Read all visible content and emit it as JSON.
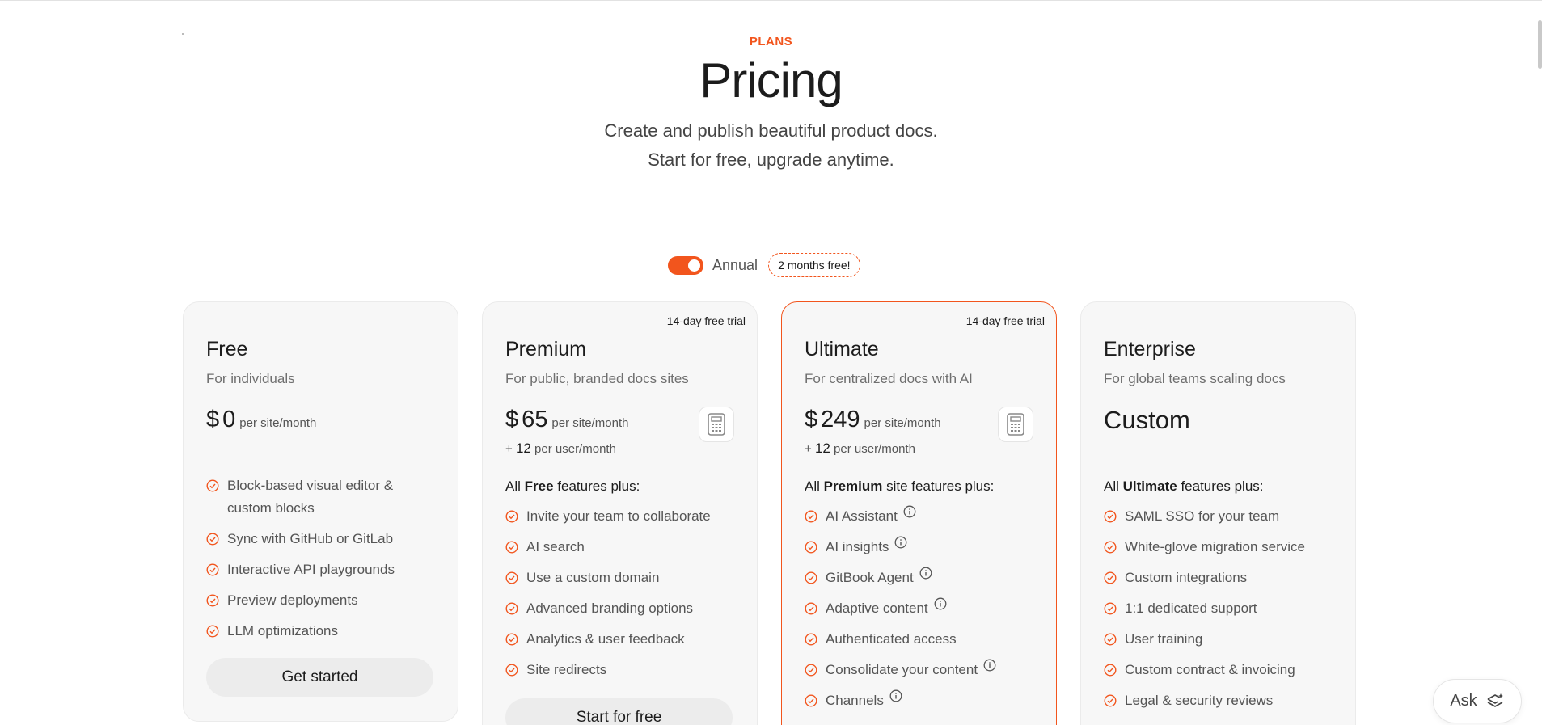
{
  "hero": {
    "eyebrow": "PLANS",
    "title": "Pricing",
    "subtitle_line1": "Create and publish beautiful product docs.",
    "subtitle_line2": "Start for free, upgrade anytime."
  },
  "billing": {
    "toggle_on": true,
    "label": "Annual",
    "badge": "2 months free!"
  },
  "colors": {
    "accent": "#f2551d",
    "card_bg": "#f7f7f7",
    "text": "#1c1c1c",
    "muted": "#6f6f6f"
  },
  "plans": [
    {
      "name": "Free",
      "description": "For individuals",
      "currency": "$",
      "price": "0",
      "price_unit": "per site/month",
      "features": [
        "Block-based visual editor & custom blocks",
        "Sync with GitHub or GitLab",
        "Interactive API playgrounds",
        "Preview deployments",
        "LLM optimizations"
      ],
      "cta": "Get started"
    },
    {
      "name": "Premium",
      "trial": "14-day free trial",
      "description": "For public, branded docs sites",
      "currency": "$",
      "price": "65",
      "price_unit": "per site/month",
      "per_user_prefix": "+",
      "per_user_amount": "12",
      "per_user_unit": "per user/month",
      "includes_prefix": "All",
      "includes_bold": "Free",
      "includes_suffix": "features plus:",
      "features": [
        "Invite your team to collaborate",
        "AI search",
        "Use a custom domain",
        "Advanced branding options",
        "Analytics & user feedback",
        "Site redirects"
      ],
      "cta": "Start for free"
    },
    {
      "name": "Ultimate",
      "trial": "14-day free trial",
      "description": "For centralized docs with AI",
      "currency": "$",
      "price": "249",
      "price_unit": "per site/month",
      "per_user_prefix": "+",
      "per_user_amount": "12",
      "per_user_unit": "per user/month",
      "includes_prefix": "All",
      "includes_bold": "Premium",
      "includes_suffix": "site features plus:",
      "features": [
        "AI Assistant",
        "AI insights",
        "GitBook Agent",
        "Adaptive content",
        "Authenticated access",
        "Consolidate your content",
        "Channels"
      ]
    },
    {
      "name": "Enterprise",
      "description": "For global teams scaling docs",
      "price_custom": "Custom",
      "includes_prefix": "All",
      "includes_bold": "Ultimate",
      "includes_suffix": "features plus:",
      "features": [
        "SAML SSO for your team",
        "White-glove migration service",
        "Custom integrations",
        "1:1 dedicated support",
        "User training",
        "Custom contract & invoicing",
        "Legal & security reviews"
      ]
    }
  ],
  "ask_button": {
    "label": "Ask",
    "icon": "sparkle-layers-icon"
  }
}
